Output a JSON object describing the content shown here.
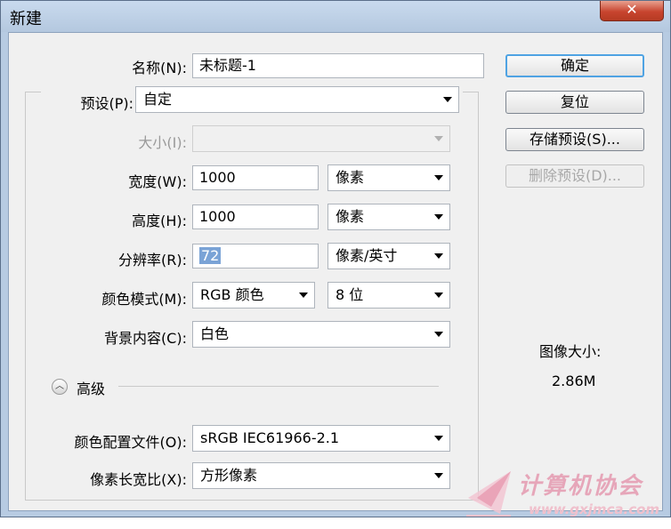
{
  "window": {
    "title": "新建",
    "close_symbol": "✕"
  },
  "form": {
    "name_label": "名称(N):",
    "name_value": "未标题-1",
    "preset_label": "预设(P):",
    "preset_value": "自定",
    "size_label": "大小(I):",
    "size_value": "",
    "width_label": "宽度(W):",
    "width_value": "1000",
    "width_unit": "像素",
    "height_label": "高度(H):",
    "height_value": "1000",
    "height_unit": "像素",
    "resolution_label": "分辨率(R):",
    "resolution_value": "72",
    "resolution_unit": "像素/英寸",
    "color_mode_label": "颜色模式(M):",
    "color_mode_value": "RGB 颜色",
    "bit_depth_value": "8 位",
    "background_label": "背景内容(C):",
    "background_value": "白色",
    "advanced_label": "高级",
    "advanced_icon": "chevron-up-icon",
    "color_profile_label": "颜色配置文件(O):",
    "color_profile_value": "sRGB IEC61966-2.1",
    "pixel_aspect_label": "像素长宽比(X):",
    "pixel_aspect_value": "方形像素"
  },
  "buttons": {
    "ok": "确定",
    "reset": "复位",
    "save_preset": "存储预设(S)...",
    "delete_preset": "删除预设(D)..."
  },
  "image_size": {
    "label": "图像大小:",
    "value": "2.86M"
  },
  "watermark": {
    "text": "计算机协会",
    "url": "www.gxjmca.com"
  },
  "colors": {
    "titlebar": "#b7cbe2",
    "dialog_bg": "#f0f0f0",
    "close_button": "#c8452f",
    "selection": "#7aa3d6"
  }
}
